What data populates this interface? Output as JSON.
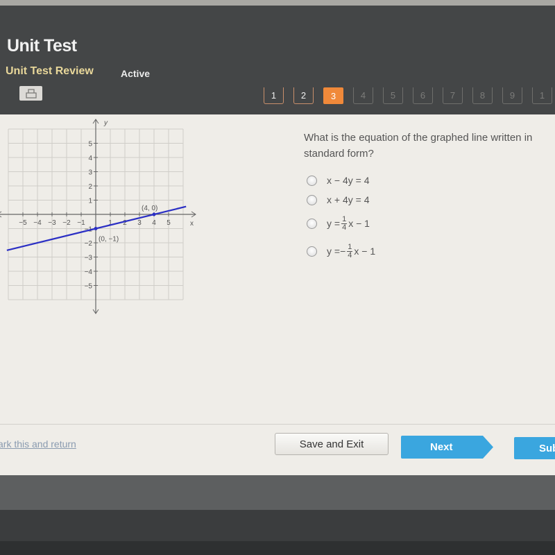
{
  "header": {
    "title": "Unit Test",
    "subtitle": "Unit Test Review",
    "status": "Active",
    "print_icon": "printer-icon"
  },
  "question_nav": {
    "current": 3,
    "items": [
      {
        "label": "1",
        "state": "answered"
      },
      {
        "label": "2",
        "state": "answered"
      },
      {
        "label": "3",
        "state": "current"
      },
      {
        "label": "4",
        "state": "future"
      },
      {
        "label": "5",
        "state": "future"
      },
      {
        "label": "6",
        "state": "future"
      },
      {
        "label": "7",
        "state": "future"
      },
      {
        "label": "8",
        "state": "future"
      },
      {
        "label": "9",
        "state": "future"
      },
      {
        "label": "1",
        "state": "future"
      }
    ],
    "accent_color": "#f0893a"
  },
  "question": {
    "line1": "What is the equation of the graphed line written in",
    "line2": "standard form?",
    "choices": [
      {
        "type": "text",
        "text": "x − 4y = 4"
      },
      {
        "type": "text",
        "text": "x + 4y = 4"
      },
      {
        "type": "fraction",
        "prefix": "y = ",
        "sign": "",
        "num": "1",
        "den": "4",
        "suffix": "x − 1"
      },
      {
        "type": "fraction",
        "prefix": "y = ",
        "sign": "−",
        "num": "1",
        "den": "4",
        "suffix": "x − 1"
      }
    ]
  },
  "graph": {
    "x_axis_label": "x",
    "y_axis_label": "y",
    "x_ticks": [
      "−5",
      "−4",
      "−3",
      "−2",
      "−1",
      "1",
      "2",
      "3",
      "4",
      "5"
    ],
    "y_ticks": [
      "5",
      "4",
      "3",
      "2",
      "1",
      "−1",
      "−2",
      "−3",
      "−4",
      "−5"
    ],
    "range": [
      -5,
      5
    ],
    "line": {
      "slope": 0.25,
      "intercept": -1,
      "color": "#2b2fc4"
    },
    "points": [
      {
        "x": 4,
        "y": 0,
        "label": "(4, 0)"
      },
      {
        "x": 0,
        "y": -1,
        "label": "(0, −1)"
      }
    ]
  },
  "footer": {
    "mark_link": "ark this and return",
    "save_exit": "Save and Exit",
    "next": "Next",
    "submit": "Sub",
    "button_color": "#3aa6df"
  }
}
